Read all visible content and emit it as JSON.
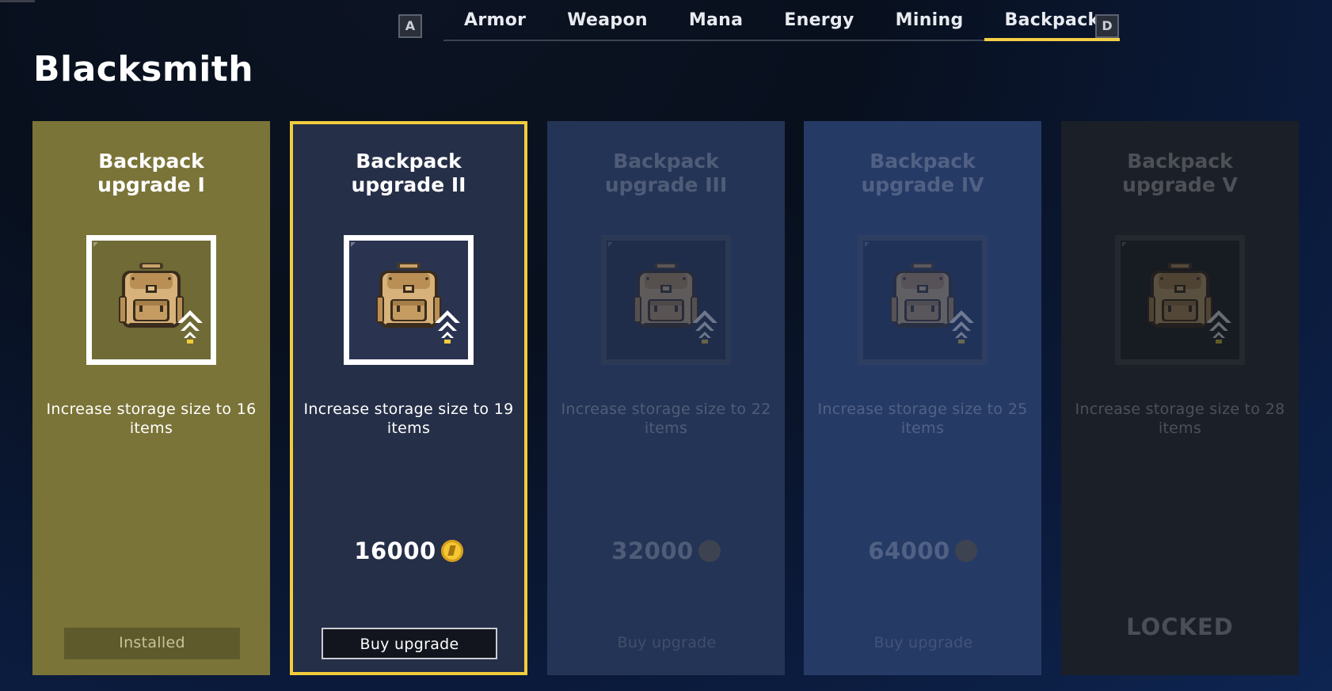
{
  "window": {
    "title": "Blacksmith"
  },
  "tab_bar": {
    "prev_key": "A",
    "next_key": "D",
    "tabs": [
      {
        "label": "Armor",
        "active": false
      },
      {
        "label": "Weapon",
        "active": false
      },
      {
        "label": "Mana",
        "active": false
      },
      {
        "label": "Energy",
        "active": false
      },
      {
        "label": "Mining",
        "active": false
      },
      {
        "label": "Backpack",
        "active": true
      }
    ]
  },
  "colors": {
    "accent": "#f2cc3b",
    "installed_card": "#7b7438",
    "selected_card": "#262f48",
    "locked_card": "#1b1f27"
  },
  "upgrades": [
    {
      "title": "Backpack upgrade I",
      "description": "Increase storage size to 16 items",
      "icon": "backpack-icon",
      "status": "installed",
      "button_label": "Installed"
    },
    {
      "title": "Backpack upgrade II",
      "description": "Increase storage size to 19 items",
      "icon": "backpack-icon",
      "status": "available",
      "price": "16000",
      "currency_icon": "gold-coin-icon",
      "button_label": "Buy upgrade"
    },
    {
      "title": "Backpack upgrade III",
      "description": "Increase storage size to 22 items",
      "icon": "backpack-icon",
      "status": "unavailable",
      "price": "32000",
      "currency_icon": "coin-icon",
      "button_label": "Buy upgrade"
    },
    {
      "title": "Backpack upgrade IV",
      "description": "Increase storage size to 25 items",
      "icon": "backpack-icon",
      "status": "unavailable",
      "price": "64000",
      "currency_icon": "coin-icon",
      "button_label": "Buy upgrade"
    },
    {
      "title": "Backpack upgrade V",
      "description": "Increase storage size to 28 items",
      "icon": "backpack-icon",
      "status": "locked",
      "locked_label": "LOCKED"
    }
  ]
}
